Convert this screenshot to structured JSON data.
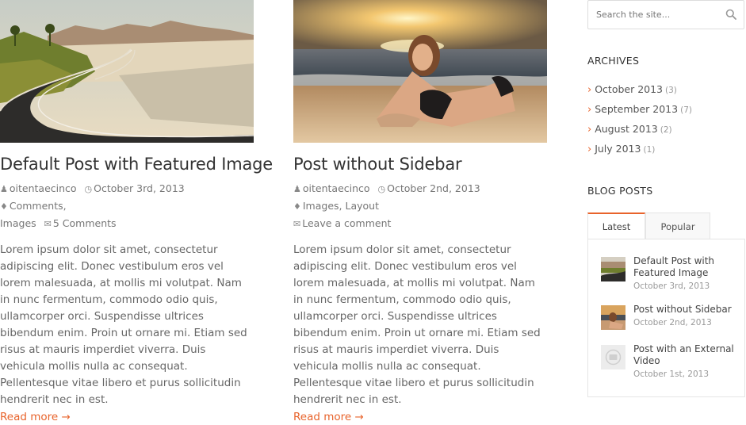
{
  "posts": [
    {
      "title": "Default Post with Featured Image",
      "author": "oitentaecinco",
      "date": "October 3rd, 2013",
      "categories": [
        "Comments,",
        "Images"
      ],
      "comments": "5 Comments",
      "excerpt": "Lorem ipsum dolor sit amet, consectetur adipiscing elit. Donec vestibulum eros vel lorem malesuada, at mollis mi volutpat. Nam in nunc fermentum, commodo odio quis, ullamcorper orci. Suspendisse ultrices bibendum enim. Proin ut ornare mi. Etiam sed risus at mauris imperdiet viverra. Duis vehicula mollis nulla ac consequat. Pellentesque vitae libero et purus sollicitudin hendrerit nec in est.",
      "read_more": "Read more →"
    },
    {
      "title": "Post without Sidebar",
      "author": "oitentaecinco",
      "date": "October 2nd, 2013",
      "categories": [
        "Images,",
        "Layout"
      ],
      "comments": "Leave a comment",
      "excerpt": "Lorem ipsum dolor sit amet, consectetur adipiscing elit. Donec vestibulum eros vel lorem malesuada, at mollis mi volutpat. Nam in nunc fermentum, commodo odio quis, ullamcorper orci. Suspendisse ultrices bibendum enim. Proin ut ornare mi. Etiam sed risus at mauris imperdiet viverra. Duis vehicula mollis nulla ac consequat. Pellentesque vitae libero et purus sollicitudin hendrerit nec in est.",
      "read_more": "Read more →"
    }
  ],
  "sidebar": {
    "search_placeholder": "Search the site...",
    "archives_title": "ARCHIVES",
    "archives": [
      {
        "label": "October 2013",
        "count": "(3)"
      },
      {
        "label": "September 2013",
        "count": "(7)"
      },
      {
        "label": "August 2013",
        "count": "(2)"
      },
      {
        "label": "July 2013",
        "count": "(1)"
      }
    ],
    "blog_posts_title": "BLOG POSTS",
    "tabs": [
      "Latest",
      "Popular"
    ],
    "latest": [
      {
        "title": "Default Post with Featured Image",
        "date": "October 3rd, 2013"
      },
      {
        "title": "Post without Sidebar",
        "date": "October 2nd, 2013"
      },
      {
        "title": "Post with an External Video",
        "date": "October 1st, 2013"
      }
    ]
  },
  "icons": {
    "author": "user-icon",
    "date": "clock-icon",
    "category": "tag-icon",
    "comments": "comments-icon",
    "search": "search-icon",
    "chevron": "chevron-right-icon"
  },
  "colors": {
    "accent": "#e8632b",
    "text": "#555555",
    "title": "#333333"
  }
}
